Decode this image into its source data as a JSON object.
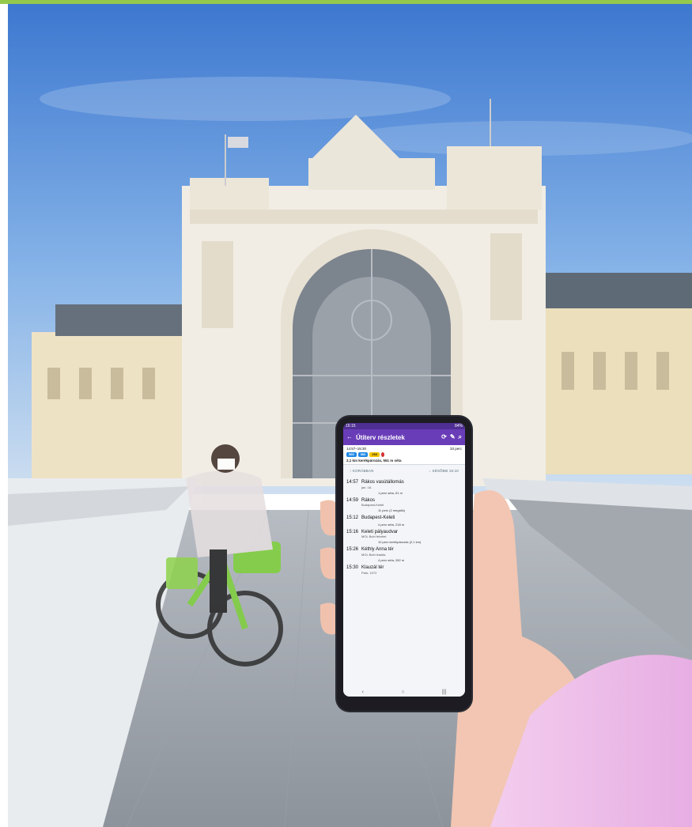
{
  "phone": {
    "status_time": "15:15",
    "status_battery": "84%",
    "app_title": "Útiterv részletek",
    "trip_times": "14:57–15:30",
    "trip_duration": "33 perc",
    "route_badges": [
      "560",
      "560",
      "260"
    ],
    "bike_summary": "2,1 km kerékpározás, 551 m séta",
    "earlier_label": "KORÁBBAN",
    "later_label": "KÉSŐBB 15:10",
    "stops": [
      {
        "time": "14:57",
        "name": "Rákos vasútállomás",
        "sub": "jan. 18.",
        "walk": "1 perc séta, 51 m"
      },
      {
        "time": "14:59",
        "name": "Rákos",
        "sub": "",
        "walk": "11 perc (2 megálló)"
      },
      {
        "time": "15:12",
        "name": "Budapest-Keleti",
        "sub": "",
        "walk": "4 perc séta, 218 m"
      },
      {
        "time": "15:16",
        "name": "Keleti pályaudvar",
        "sub": "MOL Bubi felvétel",
        "walk": "10 perc kerékpározás (2,1 km)"
      },
      {
        "time": "15:26",
        "name": "Kéthly Anna tér",
        "sub": "MOL Bubi leadás",
        "walk": "4 perc séta, 282 m"
      },
      {
        "time": "15:30",
        "name": "Klauzál tér",
        "sub": "Park, 1072",
        "walk": ""
      }
    ],
    "leg_destination": "Budapest-Keleti"
  }
}
